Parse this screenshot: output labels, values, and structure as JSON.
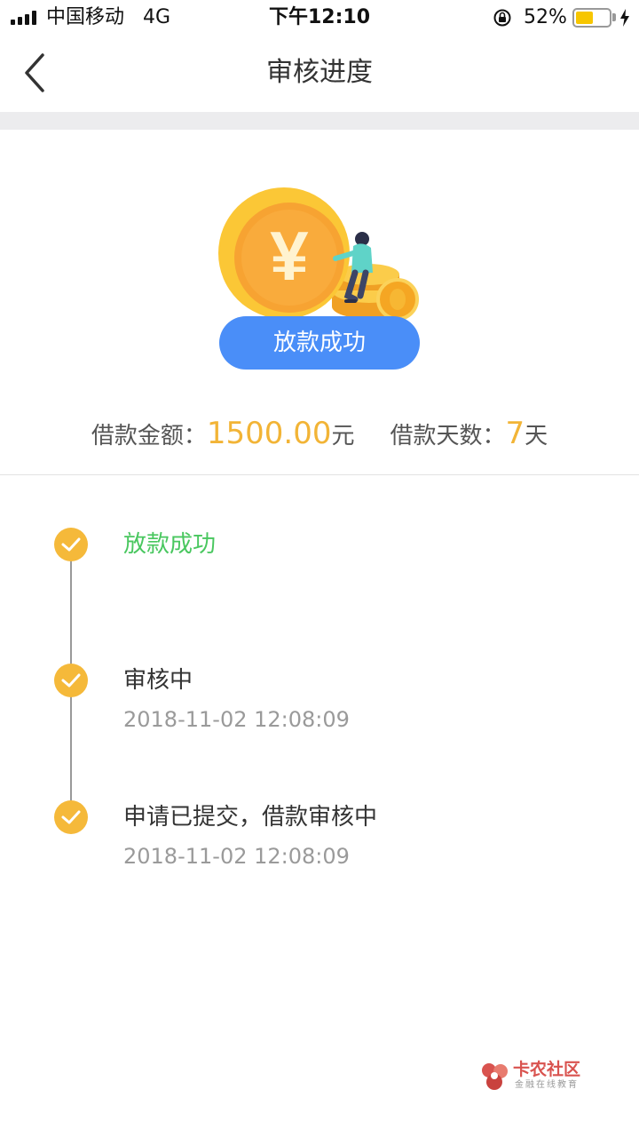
{
  "status_bar": {
    "carrier": "中国移动",
    "network": "4G",
    "time": "下午12:10",
    "battery_percent": "52%",
    "battery_level": 0.52,
    "icons": [
      "signal-icon",
      "orientation-lock-icon",
      "battery-icon",
      "charging-icon"
    ]
  },
  "nav": {
    "back_icon": "chevron-left-icon",
    "title": "审核进度"
  },
  "hero": {
    "illustration_icon": "yuan-coin-person-icon",
    "yuan_symbol": "¥",
    "status_label": "放款成功"
  },
  "loan": {
    "amount_label": "借款金额：",
    "amount_value": "1500.00",
    "amount_unit": "元",
    "days_label": "借款天数：",
    "days_value": "7",
    "days_unit": "天"
  },
  "timeline": [
    {
      "title": "放款成功",
      "time": "",
      "state": "done"
    },
    {
      "title": "审核中",
      "time": "2018-11-02 12:08:09",
      "state": "complete"
    },
    {
      "title": "申请已提交，借款审核中",
      "time": "2018-11-02 12:08:09",
      "state": "complete"
    }
  ],
  "watermark": {
    "title": "卡农社区",
    "subtitle": "金融在线教育"
  },
  "colors": {
    "accent_blue": "#4a8ef8",
    "accent_gold": "#f2b436",
    "success_green": "#49c75f",
    "muted_gray": "#9a9a9a"
  }
}
